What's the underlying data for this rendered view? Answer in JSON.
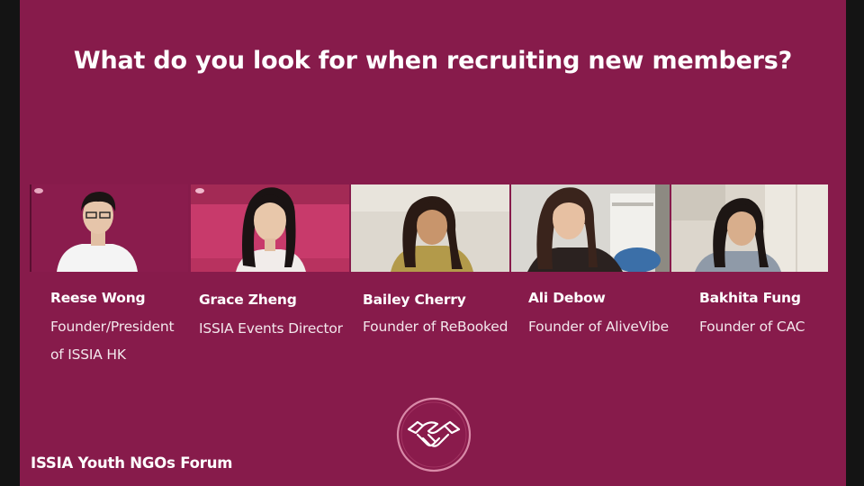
{
  "slide": {
    "title": "What do you look for when recruiting new members?",
    "footer": "ISSIA Youth NGOs Forum",
    "logo_icon": "handshake-icon",
    "background": "#871b4b"
  },
  "participants": [
    {
      "name": "Reese Wong",
      "role_lines": [
        "Founder/President",
        "of ISSIA HK"
      ]
    },
    {
      "name": "Grace Zheng",
      "role_lines": [
        "ISSIA Events Director"
      ]
    },
    {
      "name": "Bailey Cherry",
      "role_lines": [
        "Founder of ReBooked"
      ]
    },
    {
      "name": "Ali Debow",
      "role_lines": [
        "Founder of AliveVibe"
      ]
    },
    {
      "name": "Bakhita Fung",
      "role_lines": [
        "Founder of CAC"
      ]
    }
  ]
}
